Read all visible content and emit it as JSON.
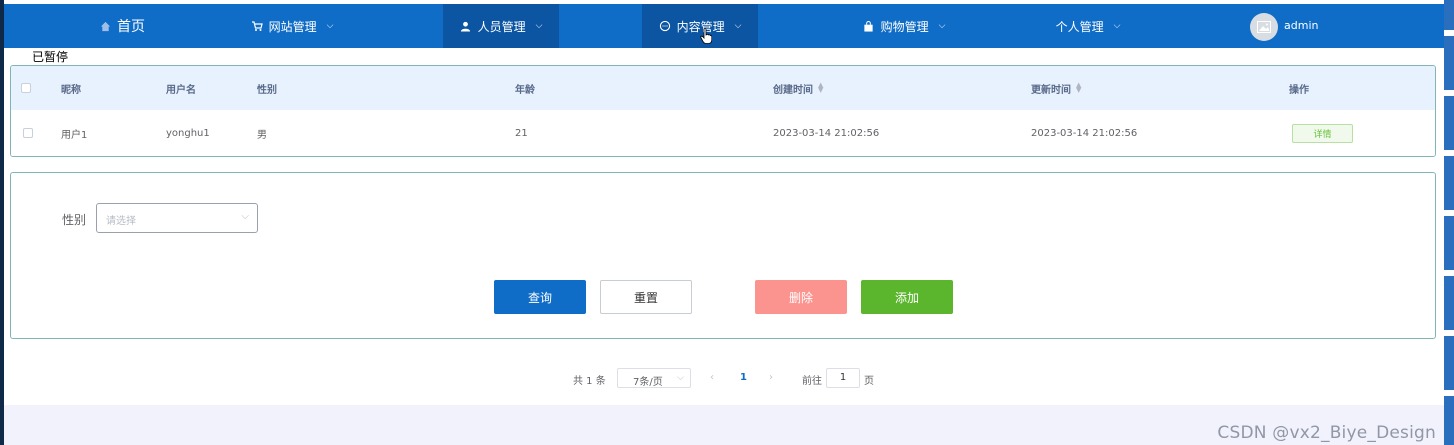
{
  "nav": {
    "home": "首页",
    "items": [
      {
        "label": "网站管理"
      },
      {
        "label": "人员管理"
      },
      {
        "label": "内容管理"
      },
      {
        "label": "购物管理"
      },
      {
        "label": "个人管理"
      }
    ],
    "user": "admin",
    "active_color": "#0b55a3",
    "bar_color": "#0f6cc7"
  },
  "status_overlay": "已暂停",
  "table": {
    "headers": [
      "昵称",
      "用户名",
      "性别",
      "年龄",
      "创建时间",
      "更新时间",
      "操作"
    ],
    "rows": [
      {
        "nickname": "用户1",
        "username": "yonghu1",
        "gender": "男",
        "age": "21",
        "created": "2023-03-14 21:02:56",
        "updated": "2023-03-14 21:02:56",
        "action": "详情"
      }
    ]
  },
  "search": {
    "gender_label": "性别",
    "gender_placeholder": "请选择",
    "query": "查询",
    "reset": "重置",
    "delete": "删除",
    "add": "添加"
  },
  "pagination": {
    "total": "共 1 条",
    "page_size": "7条/页",
    "current_page": "1",
    "goto_label": "前往",
    "goto_value": "1",
    "goto_unit": "页"
  },
  "watermark": "CSDN @vx2_Biye_Design"
}
